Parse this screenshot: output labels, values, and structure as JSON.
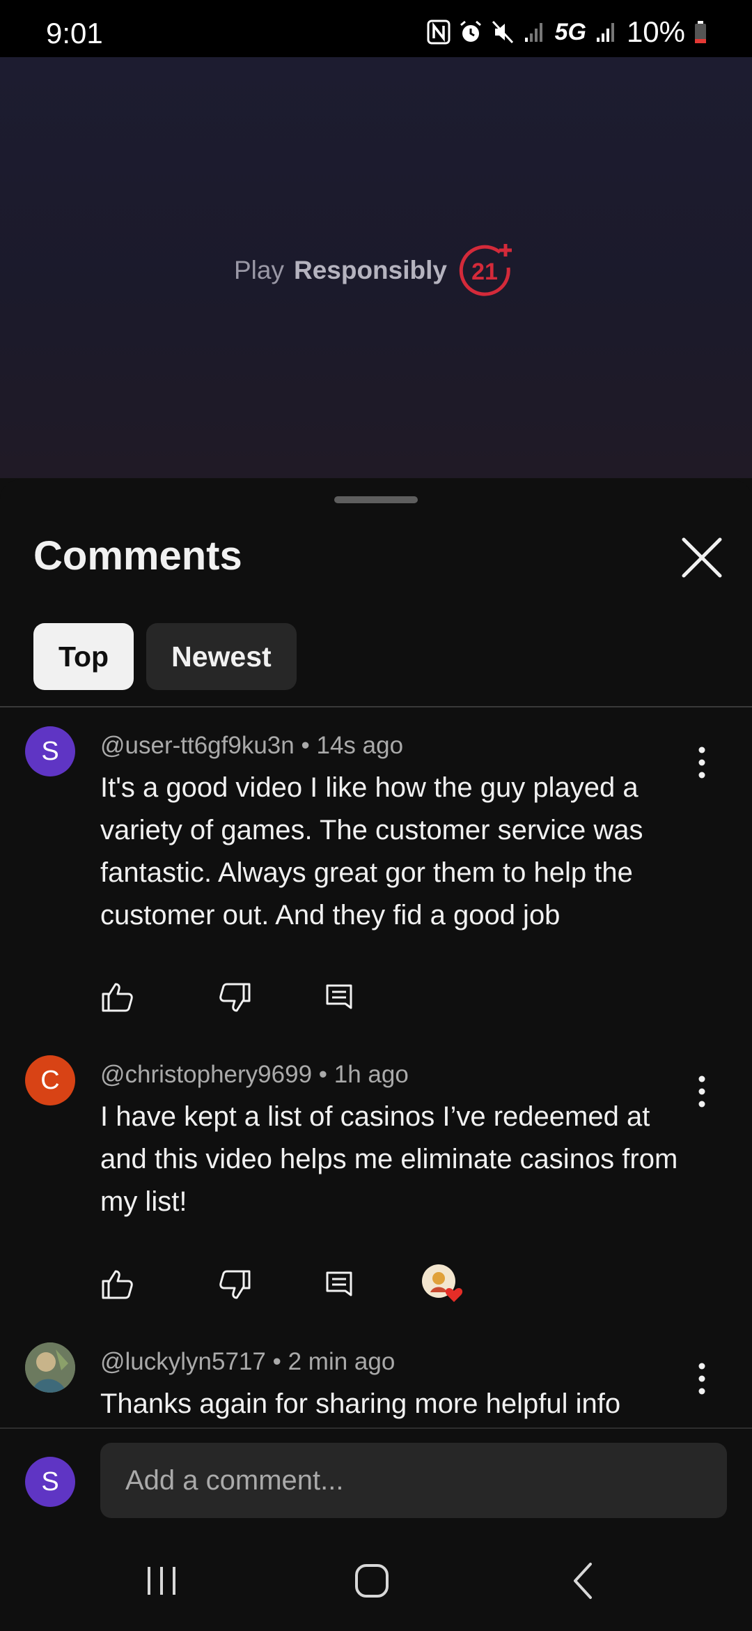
{
  "status_bar": {
    "time": "9:01",
    "network": "5G",
    "battery": "10%"
  },
  "video": {
    "overlay_text_1": "Play",
    "overlay_text_2": "Responsibly",
    "badge_text": "21",
    "badge_color": "#d42a3a"
  },
  "comments_panel": {
    "title": "Comments",
    "close_icon": "close-icon",
    "tabs": [
      {
        "label": "Top",
        "selected": true
      },
      {
        "label": "Newest",
        "selected": false
      }
    ],
    "items": [
      {
        "avatar_letter": "S",
        "avatar_color": "#5f35c4",
        "author": "@user-tt6gf9ku3n",
        "time": "14s ago",
        "text": "It's a good video I like how the guy played a variety of games. The customer service was fantastic. Always great gor them to help the customer out. And they fid a good job"
      },
      {
        "avatar_letter": "C",
        "avatar_color": "#d84315",
        "author": "@christophery9699",
        "time": "1h ago",
        "text": "I have kept a list of casinos I’ve redeemed at and this video helps me eliminate casinos from my list!",
        "creator_hearted": true
      },
      {
        "avatar_letter": "",
        "avatar_color": "#5a6b52",
        "author": "@luckylyn5717",
        "time": "2 min ago",
        "text": "Thanks again for sharing more helpful info"
      }
    ],
    "separator": "•",
    "add_comment": {
      "avatar_letter": "S",
      "placeholder": "Add a comment..."
    }
  },
  "nav": {
    "recents_icon": "recents-icon",
    "home_icon": "home-icon",
    "back_icon": "back-icon"
  }
}
